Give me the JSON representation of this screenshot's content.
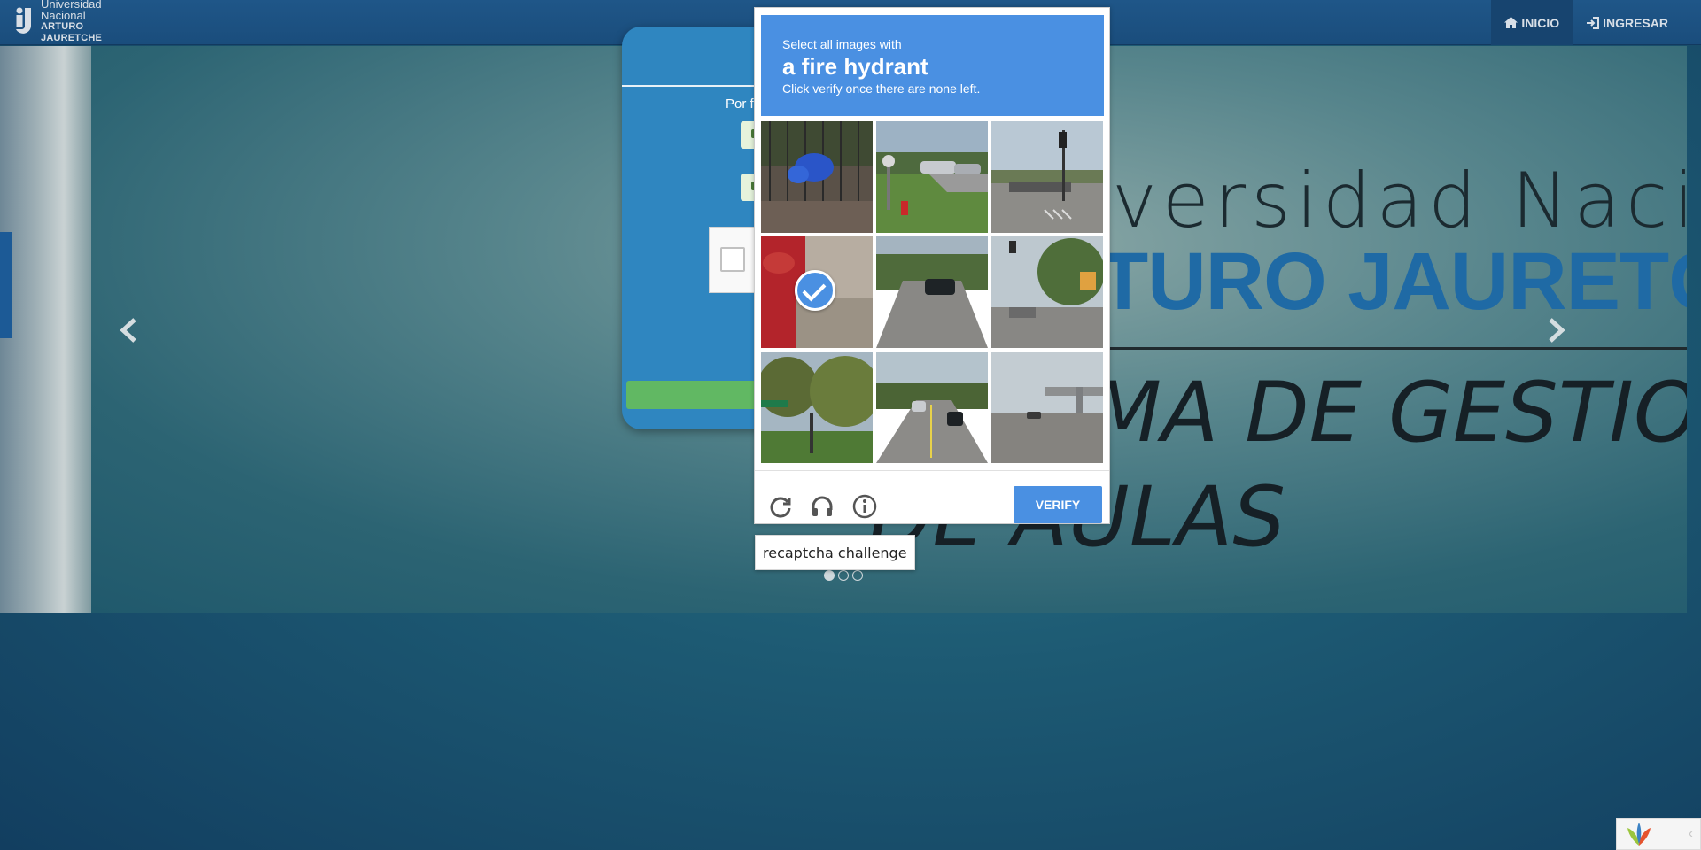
{
  "navbar": {
    "brand": {
      "line1": "Universidad Nacional",
      "line2": "ARTURO JAURETCHE"
    },
    "items": [
      {
        "label": "INICIO",
        "icon": "home-icon",
        "active": true
      },
      {
        "label": "INGRESAR",
        "icon": "sign-in-icon",
        "active": false
      }
    ]
  },
  "carousel": {
    "title1": "versidad Naciona",
    "title2": "TURO JAURETCHE",
    "title3": "MA DE GESTION",
    "title4": "DE AULAS",
    "prev_icon": "chevron-left-icon",
    "next_icon": "chevron-right-icon",
    "slides_total": 3,
    "active_slide": 1
  },
  "login": {
    "prompt": "Por fa"
  },
  "recaptcha": {
    "instruction_top": "Select all images with",
    "instruction_target": "a fire hydrant",
    "instruction_bottom": "Click verify once there are none left.",
    "verify_label": "VERIFY",
    "tiles": [
      {
        "scene": "blue bags by fence",
        "selected": false
      },
      {
        "scene": "lawn with fire hydrant",
        "selected": false
      },
      {
        "scene": "intersection with traffic light",
        "selected": false
      },
      {
        "scene": "fire hydrant close-up",
        "selected": true
      },
      {
        "scene": "street with black car",
        "selected": false
      },
      {
        "scene": "traffic light and trees",
        "selected": false
      },
      {
        "scene": "trees and street sign",
        "selected": false
      },
      {
        "scene": "road with cars",
        "selected": false
      },
      {
        "scene": "overpass road",
        "selected": false
      }
    ],
    "footer_icons": [
      "reload-icon",
      "audio-headphones-icon",
      "info-icon"
    ]
  },
  "tooltip": "recaptcha challenge",
  "colors": {
    "navbar": "#1f5688",
    "recaptcha_blue": "#4a90e2",
    "login_panel": "#2f86c0",
    "submit_green": "#61b863"
  }
}
